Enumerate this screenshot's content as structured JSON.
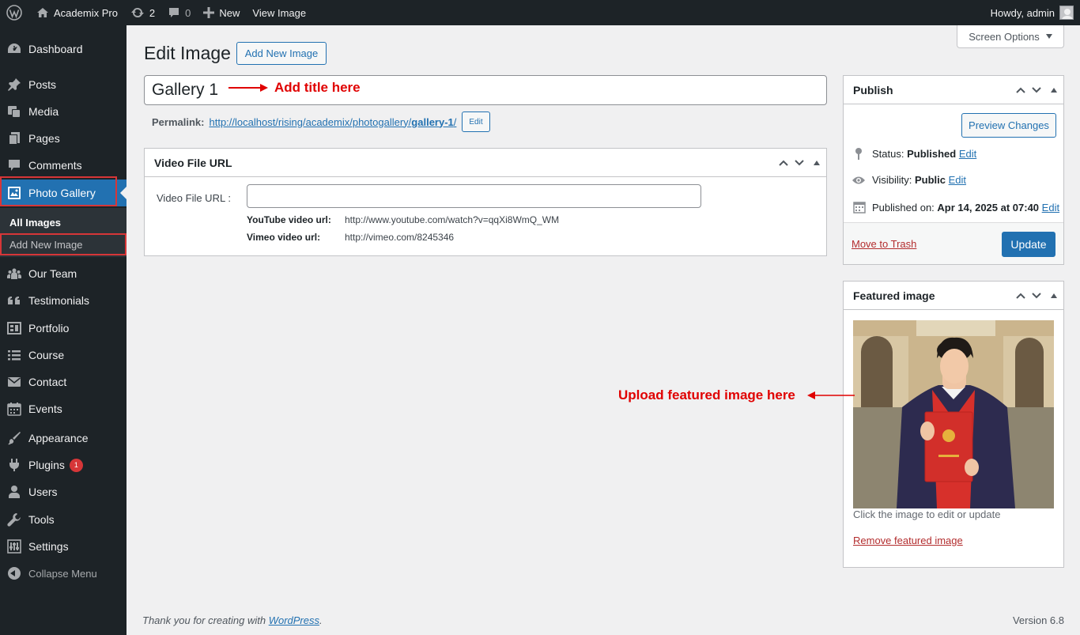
{
  "adminbar": {
    "site_name": "Academix Pro",
    "updates_count": "2",
    "comments_count": "0",
    "new_label": "New",
    "view_label": "View Image",
    "howdy": "Howdy, admin"
  },
  "sidebar": {
    "items": [
      {
        "label": "Dashboard",
        "icon": "dashboard-icon"
      },
      {
        "label": "Posts",
        "icon": "pin-icon"
      },
      {
        "label": "Media",
        "icon": "media-icon"
      },
      {
        "label": "Pages",
        "icon": "page-icon"
      },
      {
        "label": "Comments",
        "icon": "comment-icon"
      },
      {
        "label": "Photo Gallery",
        "icon": "gallery-icon"
      },
      {
        "label": "Our Team",
        "icon": "team-icon"
      },
      {
        "label": "Testimonials",
        "icon": "quote-icon"
      },
      {
        "label": "Portfolio",
        "icon": "portfolio-icon"
      },
      {
        "label": "Course",
        "icon": "list-icon"
      },
      {
        "label": "Contact",
        "icon": "envelope-icon"
      },
      {
        "label": "Events",
        "icon": "calendar-icon"
      },
      {
        "label": "Appearance",
        "icon": "brush-icon"
      },
      {
        "label": "Plugins",
        "icon": "plugin-icon",
        "badge": "1"
      },
      {
        "label": "Users",
        "icon": "user-icon"
      },
      {
        "label": "Tools",
        "icon": "wrench-icon"
      },
      {
        "label": "Settings",
        "icon": "settings-icon"
      }
    ],
    "submenu": [
      "All Images",
      "Add New Image"
    ],
    "collapse_label": "Collapse Menu"
  },
  "screen_options": "Screen Options",
  "page_title": "Edit Image",
  "add_new_button": "Add New Image",
  "title_input_value": "Gallery 1",
  "annotation_title": "Add title here",
  "permalink": {
    "label": "Permalink:",
    "url_base": "http://localhost/rising/academix/photogallery/",
    "slug": "gallery-1",
    "trailing": "/",
    "edit_label": "Edit"
  },
  "video_box": {
    "title": "Video File URL",
    "field_label": "Video File URL :",
    "field_value": "",
    "youtube_label": "YouTube video url:",
    "youtube_value": "http://www.youtube.com/watch?v=qqXi8WmQ_WM",
    "vimeo_label": "Vimeo video url:",
    "vimeo_value": "http://vimeo.com/8245346"
  },
  "publish": {
    "title": "Publish",
    "preview_button": "Preview Changes",
    "status_label": "Status:",
    "status_value": "Published",
    "visibility_label": "Visibility:",
    "visibility_value": "Public",
    "published_label": "Published on:",
    "published_value": "Apr 14, 2025 at 07:40",
    "edit_label": "Edit",
    "trash_label": "Move to Trash",
    "update_button": "Update"
  },
  "featured": {
    "title": "Featured image",
    "hint": "Click the image to edit or update",
    "remove_label": "Remove featured image",
    "annotation": "Upload featured image here"
  },
  "footer": {
    "thanks_prefix": "Thank you for creating with ",
    "wp_link": "WordPress",
    "thanks_suffix": ".",
    "version": "Version 6.8"
  },
  "colors": {
    "accent": "#2271b1",
    "sidebar_bg": "#1d2327",
    "annotation": "#e00000"
  }
}
